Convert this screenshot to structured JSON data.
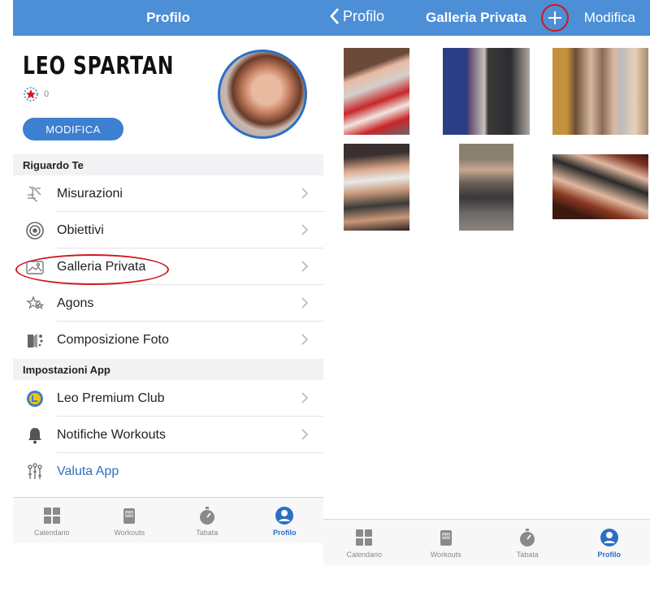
{
  "profile": {
    "nav_title": "Profilo",
    "name": "LEO SPARTAN",
    "rank_count": "0",
    "edit_label": "MODIFICA",
    "sections": [
      {
        "title": "Riguardo Te",
        "items": [
          {
            "label": "Misurazioni",
            "icon": "measurements-icon"
          },
          {
            "label": "Obiettivi",
            "icon": "target-icon"
          },
          {
            "label": "Galleria Privata",
            "icon": "gallery-icon"
          },
          {
            "label": "Agons",
            "icon": "stars-icon"
          },
          {
            "label": "Composizione Foto",
            "icon": "photo-compose-icon"
          }
        ]
      },
      {
        "title": "Impostazioni App",
        "items": [
          {
            "label": "Leo Premium Club",
            "icon": "premium-icon"
          },
          {
            "label": "Notifiche Workouts",
            "icon": "bell-icon"
          },
          {
            "label": "Valuta App",
            "icon": "rate-icon"
          }
        ]
      }
    ]
  },
  "gallery": {
    "back_label": "Profilo",
    "title": "Galleria Privata",
    "edit_label": "Modifica"
  },
  "tabs": [
    {
      "label": "Calendario",
      "icon": "calendar-grid-icon"
    },
    {
      "label": "Workouts",
      "icon": "workouts-icon"
    },
    {
      "label": "Tabata",
      "icon": "stopwatch-icon"
    },
    {
      "label": "Profilo",
      "icon": "profile-icon"
    }
  ],
  "colors": {
    "navbar": "#4d8fd6",
    "accent": "#2b6fc4",
    "highlight": "#d0161c"
  }
}
